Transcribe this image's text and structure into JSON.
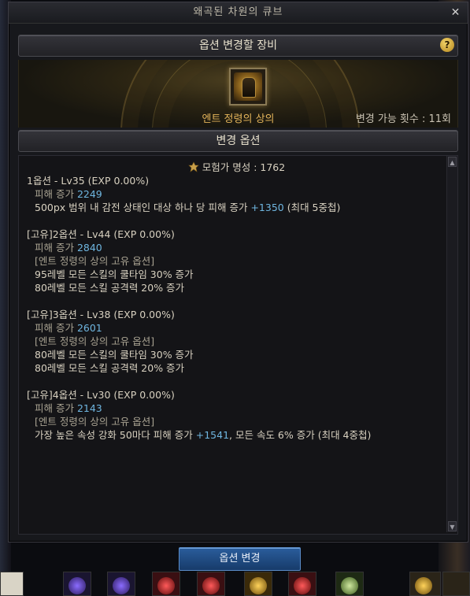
{
  "window": {
    "title": "왜곡된 차원의 큐브",
    "close_glyph": "✕"
  },
  "equipment_section": {
    "header": "옵션 변경할 장비",
    "help_glyph": "?",
    "item_name": "엔트 정령의 상의",
    "change_count": "변경 가능 횟수 : 11회"
  },
  "options_section": {
    "header": "변경 옵션",
    "fame": "모험가 명성 : 1762",
    "options": [
      {
        "title": "1옵션 - Lv35 (EXP 0.00%)",
        "damage_label": "피해 증가 ",
        "damage_value": "2249",
        "unique": "",
        "line1_text": "500px 범위 내 감전 상태인 대상 하나 당 피해 증가 ",
        "line1_value": "+1350",
        "line1_suffix": " (최대 5중첩)",
        "line2_text": ""
      },
      {
        "title": "[고유]2옵션 - Lv44 (EXP 0.00%)",
        "damage_label": "피해 증가 ",
        "damage_value": "2840",
        "unique": "[엔트 정령의 상의 고유 옵션]",
        "line1_text": "95레벨 모든 스킬의 쿨타임 30% 증가",
        "line2_text": "80레벨 모든 스킬 공격력 20% 증가"
      },
      {
        "title": "[고유]3옵션 - Lv38 (EXP 0.00%)",
        "damage_label": "피해 증가 ",
        "damage_value": "2601",
        "unique": "[엔트 정령의 상의 고유 옵션]",
        "line1_text": "80레벨 모든 스킬의 쿨타임 30% 증가",
        "line2_text": "80레벨 모든 스킬 공격력 20% 증가"
      },
      {
        "title": "[고유]4옵션 - Lv30 (EXP 0.00%)",
        "damage_label": "피해 증가 ",
        "damage_value": "2143",
        "unique": "[엔트 정령의 상의 고유 옵션]",
        "line1_text": "가장 높은 속성 강화 50마다 피해 증가 ",
        "line1_value": "+1541",
        "line1_suffix": ", 모든 속도 6% 증가 (최대 4중첩)"
      }
    ],
    "scroll_up_glyph": "▲",
    "scroll_down_glyph": "▼"
  },
  "actions": {
    "change_button": "옵션 변경"
  },
  "colors": {
    "accent_blue": "#6fb6e0",
    "item_gold": "#e3b45a",
    "button_blue": "#2a5d9c"
  },
  "inventory_icons": [
    "purple-orb-icon",
    "purple-orb-icon",
    "red-gem-icon",
    "red-gem-icon",
    "gold-coin-icon",
    "red-gem-icon",
    "green-scroll-icon"
  ]
}
